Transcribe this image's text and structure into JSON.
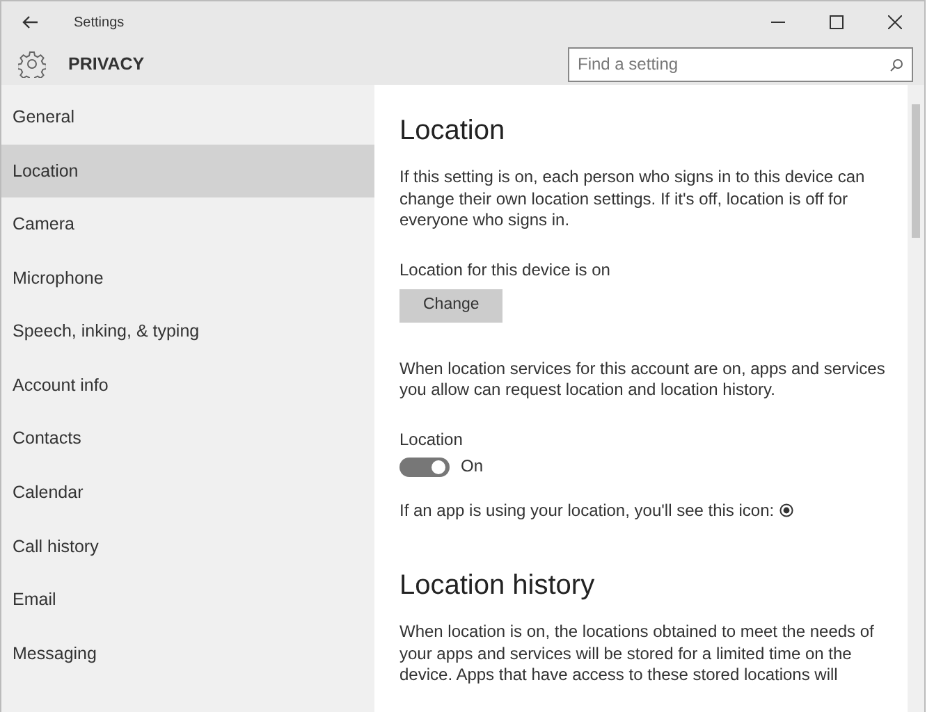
{
  "window": {
    "title": "Settings"
  },
  "header": {
    "title": "PRIVACY",
    "search": {
      "placeholder": "Find a setting"
    }
  },
  "sidebar": {
    "items": [
      {
        "label": "General",
        "selected": false
      },
      {
        "label": "Location",
        "selected": true
      },
      {
        "label": "Camera",
        "selected": false
      },
      {
        "label": "Microphone",
        "selected": false
      },
      {
        "label": "Speech, inking, & typing",
        "selected": false
      },
      {
        "label": "Account info",
        "selected": false
      },
      {
        "label": "Contacts",
        "selected": false
      },
      {
        "label": "Calendar",
        "selected": false
      },
      {
        "label": "Call history",
        "selected": false
      },
      {
        "label": "Email",
        "selected": false
      },
      {
        "label": "Messaging",
        "selected": false
      }
    ]
  },
  "content": {
    "sections": [
      {
        "kind": "heading",
        "text": "Location"
      },
      {
        "kind": "paragraph",
        "text": "If this setting is on, each person who signs in to this device can change their own location settings. If it's off, location is off for everyone who signs in."
      },
      {
        "kind": "status",
        "text": "Location for this device is on"
      },
      {
        "kind": "button",
        "text": "Change"
      },
      {
        "kind": "paragraph",
        "text": "When location services for this account are on, apps and services you allow can request location and location history."
      },
      {
        "kind": "toggle",
        "label": "Location",
        "on": true,
        "state_text": "On"
      },
      {
        "kind": "icon-note",
        "text": "If an app is using your location, you'll see this icon:"
      },
      {
        "kind": "heading",
        "text": "Location history"
      },
      {
        "kind": "paragraph",
        "text": "When location is on, the locations obtained to meet the needs of your apps and services will be stored for a limited time on the device. Apps that have access to these stored locations will"
      }
    ]
  }
}
